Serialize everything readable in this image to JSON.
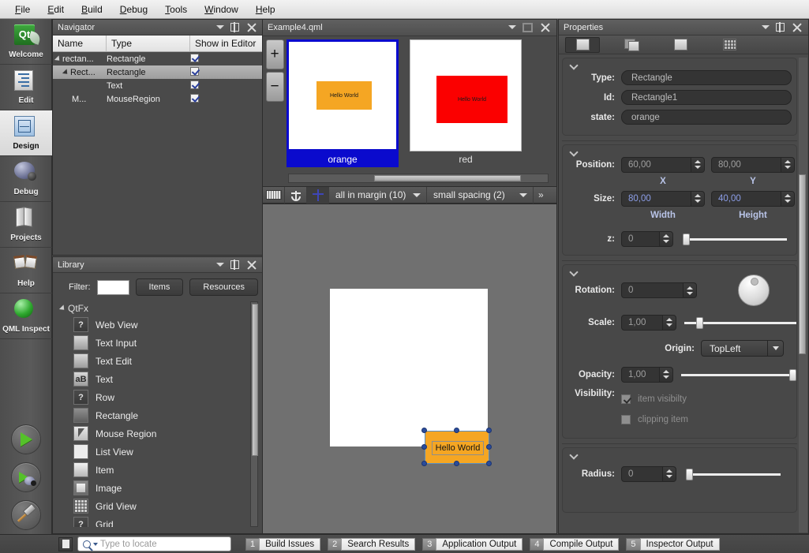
{
  "menu": {
    "items": [
      "File",
      "Edit",
      "Build",
      "Debug",
      "Tools",
      "Window",
      "Help"
    ]
  },
  "modebar": {
    "modes": [
      {
        "label": "Welcome",
        "icon": "qt-logo-icon",
        "active": false
      },
      {
        "label": "Edit",
        "icon": "document-edit-icon",
        "active": false
      },
      {
        "label": "Design",
        "icon": "design-canvas-icon",
        "active": true
      },
      {
        "label": "Debug",
        "icon": "bug-icon",
        "active": false
      },
      {
        "label": "Projects",
        "icon": "folders-icon",
        "active": false
      },
      {
        "label": "Help",
        "icon": "book-icon",
        "active": false
      },
      {
        "label": "QML Inspect",
        "icon": "green-sphere-icon",
        "active": false
      }
    ],
    "actions": [
      {
        "name": "run-button",
        "icon": "play-icon"
      },
      {
        "name": "debug-button",
        "icon": "play-bug-icon"
      },
      {
        "name": "build-button",
        "icon": "hammer-icon"
      }
    ]
  },
  "navigator": {
    "title": "Navigator",
    "columns": [
      "Name",
      "Type",
      "Show in Editor"
    ],
    "rows": [
      {
        "name": "rectan...",
        "type": "Rectangle",
        "show": true,
        "indent": 0,
        "expander": true,
        "selected": false
      },
      {
        "name": "Rect...",
        "type": "Rectangle",
        "show": true,
        "indent": 1,
        "expander": true,
        "selected": true
      },
      {
        "name": "",
        "type": "Text",
        "show": true,
        "indent": 2,
        "expander": false,
        "selected": false
      },
      {
        "name": "M...",
        "type": "MouseRegion",
        "show": true,
        "indent": 2,
        "expander": false,
        "selected": false
      }
    ]
  },
  "library": {
    "title": "Library",
    "filter_label": "Filter:",
    "filter_value": "",
    "tabs": [
      {
        "label": "Items",
        "active": true
      },
      {
        "label": "Resources",
        "active": false
      }
    ],
    "group": "QtFx",
    "items": [
      {
        "label": "Web View",
        "icon": "question-icon"
      },
      {
        "label": "Text Input",
        "icon": "text-lines-icon"
      },
      {
        "label": "Text Edit",
        "icon": "text-lines-icon"
      },
      {
        "label": "Text",
        "icon": "ab-icon"
      },
      {
        "label": "Row",
        "icon": "question-icon"
      },
      {
        "label": "Rectangle",
        "icon": "rectangle-icon"
      },
      {
        "label": "Mouse Region",
        "icon": "cursor-icon"
      },
      {
        "label": "List View",
        "icon": "list-icon"
      },
      {
        "label": "Item",
        "icon": "item-icon"
      },
      {
        "label": "Image",
        "icon": "image-icon"
      },
      {
        "label": "Grid View",
        "icon": "grid-icon"
      },
      {
        "label": "Grid",
        "icon": "question-icon"
      }
    ]
  },
  "states": {
    "file_title": "Example4.qml",
    "zoom_in": "+",
    "zoom_out": "−",
    "list": [
      {
        "label": "orange",
        "selected": true,
        "fill": "#f5a623",
        "text": "Hello World"
      },
      {
        "label": "red",
        "selected": false,
        "fill": "#fb0000",
        "text": "Hello World"
      }
    ]
  },
  "design_toolbar": {
    "buttons": [
      {
        "name": "ruler-icon",
        "active": false
      },
      {
        "name": "anchor-icon",
        "active": false
      },
      {
        "name": "layout-crosshair-icon",
        "active": true
      }
    ],
    "margin_combo": "all in margin (10)",
    "spacing_combo": "small spacing (2)",
    "overflow": "»"
  },
  "canvas": {
    "item_text": "Hello World",
    "item_fill": "#f5a623"
  },
  "properties": {
    "title": "Properties",
    "tabs": [
      {
        "name": "tab-basic",
        "icon": "filled-square-icon",
        "active": true
      },
      {
        "name": "tab-layout",
        "icon": "stacked-squares-icon",
        "active": false
      },
      {
        "name": "tab-advanced",
        "icon": "square-icon",
        "active": false
      },
      {
        "name": "tab-grid",
        "icon": "grid-icon",
        "active": false
      }
    ],
    "identity": {
      "type_label": "Type:",
      "type_value": "Rectangle",
      "id_label": "Id:",
      "id_value": "Rectangle1",
      "state_label": "state:",
      "state_value": "orange"
    },
    "geometry": {
      "position_label": "Position:",
      "position_x": "60,00",
      "position_y": "80,00",
      "x_axis": "X",
      "y_axis": "Y",
      "size_label": "Size:",
      "width_value": "80,00",
      "height_value": "40,00",
      "width_axis": "Width",
      "height_axis": "Height",
      "z_label": "z:",
      "z_value": "0"
    },
    "transform": {
      "rotation_label": "Rotation:",
      "rotation_value": "0",
      "scale_label": "Scale:",
      "scale_value": "1,00",
      "origin_label": "Origin:",
      "origin_value": "TopLeft",
      "opacity_label": "Opacity:",
      "opacity_value": "1,00",
      "visibility_label": "Visibility:",
      "visible_checkbox": "item visibilty",
      "visible_checked": true,
      "clipping_checkbox": "clipping item",
      "clipping_checked": false
    },
    "appearance": {
      "radius_label": "Radius:",
      "radius_value": "0"
    }
  },
  "statusbar": {
    "locate_placeholder": "Type to locate",
    "outputs": [
      {
        "num": "1",
        "label": "Build Issues"
      },
      {
        "num": "2",
        "label": "Search Results"
      },
      {
        "num": "3",
        "label": "Application Output"
      },
      {
        "num": "4",
        "label": "Compile Output"
      },
      {
        "num": "5",
        "label": "Inspector Output"
      }
    ]
  },
  "colors": {
    "selection_blue": "#0a0acd",
    "orange": "#f5a623",
    "red": "#fb0000",
    "handle_blue": "#2b4c9b"
  }
}
